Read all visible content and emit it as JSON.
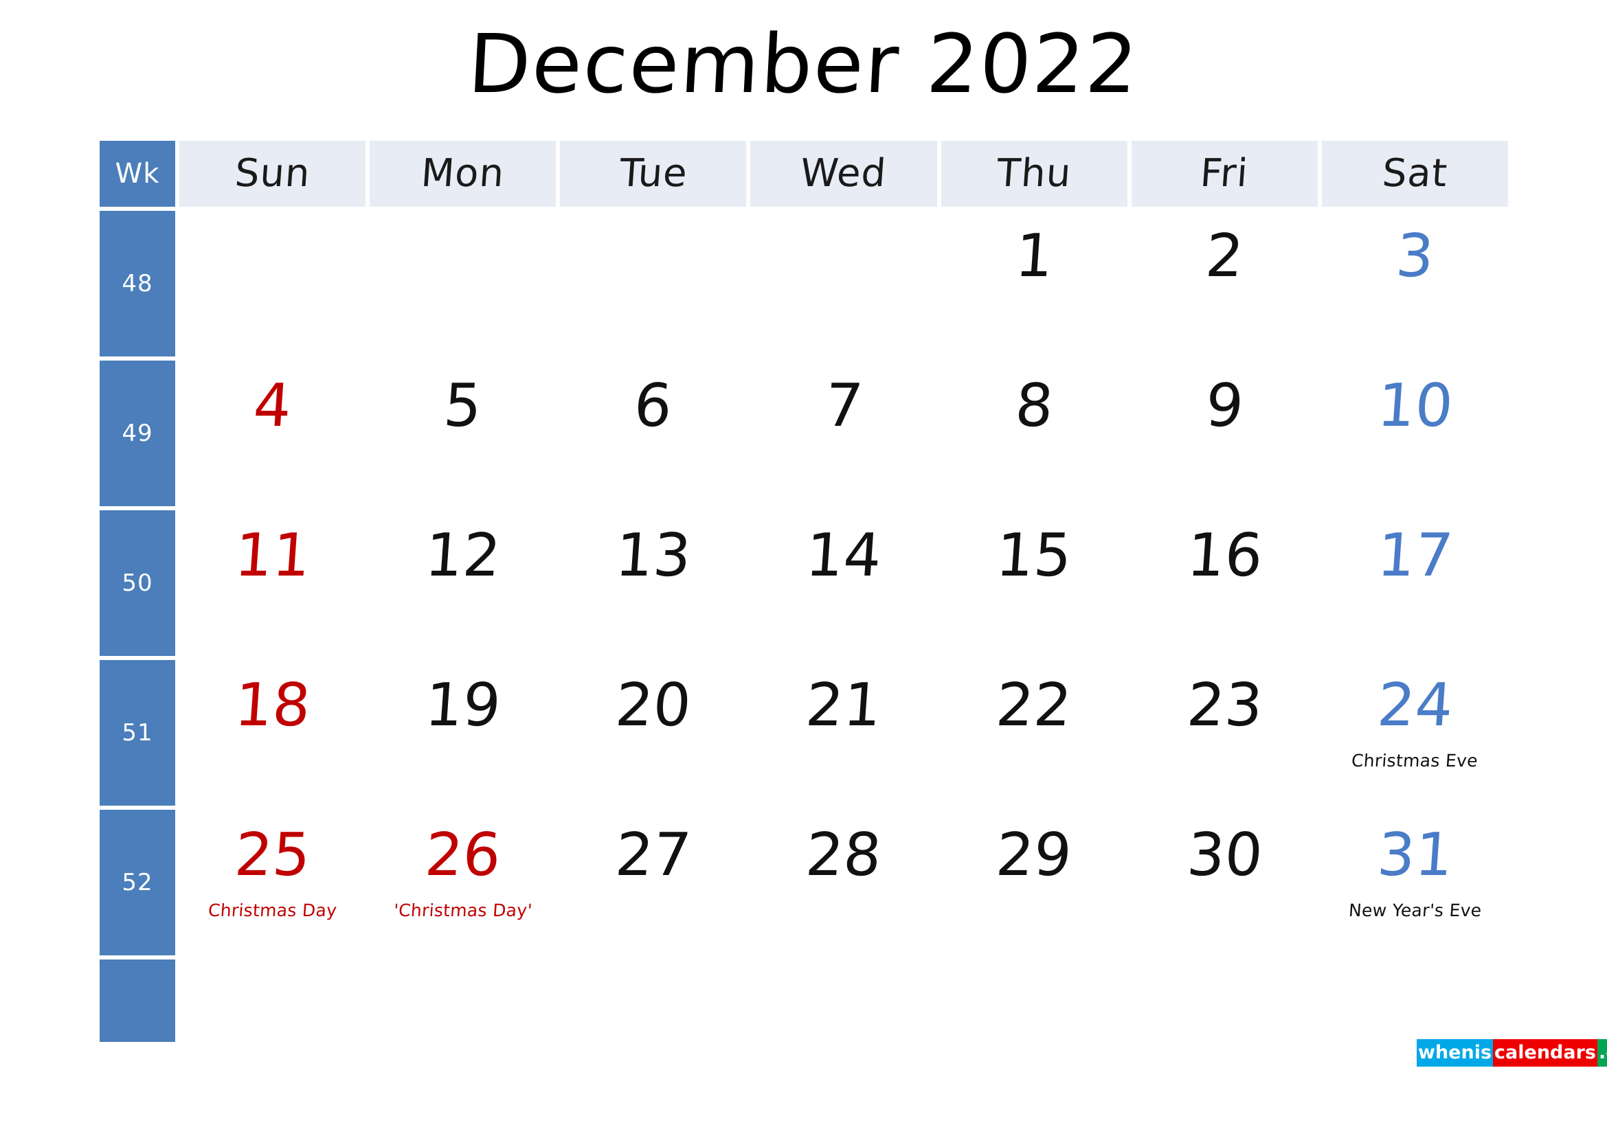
{
  "title": "December 2022",
  "colors": {
    "week_column_bg": "#4b7eba",
    "header_cell_bg": "#e8ecf4",
    "sunday_red": "#c00000",
    "saturday_blue": "#4a7cc7",
    "weekday_black": "#111111",
    "page_bg": "#ffffff"
  },
  "header": {
    "week_label": "Wk",
    "days": [
      "Sun",
      "Mon",
      "Tue",
      "Wed",
      "Thu",
      "Fri",
      "Sat"
    ]
  },
  "weeks": [
    {
      "week_number": "48",
      "days": [
        {
          "date": "",
          "kind": "empty",
          "note": ""
        },
        {
          "date": "",
          "kind": "empty",
          "note": ""
        },
        {
          "date": "",
          "kind": "empty",
          "note": ""
        },
        {
          "date": "",
          "kind": "empty",
          "note": ""
        },
        {
          "date": "1",
          "kind": "weekday",
          "note": ""
        },
        {
          "date": "2",
          "kind": "weekday",
          "note": ""
        },
        {
          "date": "3",
          "kind": "saturday",
          "note": ""
        }
      ]
    },
    {
      "week_number": "49",
      "days": [
        {
          "date": "4",
          "kind": "sunday",
          "note": ""
        },
        {
          "date": "5",
          "kind": "weekday",
          "note": ""
        },
        {
          "date": "6",
          "kind": "weekday",
          "note": ""
        },
        {
          "date": "7",
          "kind": "weekday",
          "note": ""
        },
        {
          "date": "8",
          "kind": "weekday",
          "note": ""
        },
        {
          "date": "9",
          "kind": "weekday",
          "note": ""
        },
        {
          "date": "10",
          "kind": "saturday",
          "note": ""
        }
      ]
    },
    {
      "week_number": "50",
      "days": [
        {
          "date": "11",
          "kind": "sunday",
          "note": ""
        },
        {
          "date": "12",
          "kind": "weekday",
          "note": ""
        },
        {
          "date": "13",
          "kind": "weekday",
          "note": ""
        },
        {
          "date": "14",
          "kind": "weekday",
          "note": ""
        },
        {
          "date": "15",
          "kind": "weekday",
          "note": ""
        },
        {
          "date": "16",
          "kind": "weekday",
          "note": ""
        },
        {
          "date": "17",
          "kind": "saturday",
          "note": ""
        }
      ]
    },
    {
      "week_number": "51",
      "days": [
        {
          "date": "18",
          "kind": "sunday",
          "note": ""
        },
        {
          "date": "19",
          "kind": "weekday",
          "note": ""
        },
        {
          "date": "20",
          "kind": "weekday",
          "note": ""
        },
        {
          "date": "21",
          "kind": "weekday",
          "note": ""
        },
        {
          "date": "22",
          "kind": "weekday",
          "note": ""
        },
        {
          "date": "23",
          "kind": "weekday",
          "note": ""
        },
        {
          "date": "24",
          "kind": "saturday",
          "note": "Christmas Eve",
          "note_color": "black"
        }
      ]
    },
    {
      "week_number": "52",
      "days": [
        {
          "date": "25",
          "kind": "sunday",
          "note": "Christmas Day",
          "note_color": "red"
        },
        {
          "date": "26",
          "kind": "holiday-red",
          "note": "'Christmas Day'",
          "note_color": "red"
        },
        {
          "date": "27",
          "kind": "weekday",
          "note": ""
        },
        {
          "date": "28",
          "kind": "weekday",
          "note": ""
        },
        {
          "date": "29",
          "kind": "weekday",
          "note": ""
        },
        {
          "date": "30",
          "kind": "weekday",
          "note": ""
        },
        {
          "date": "31",
          "kind": "saturday",
          "note": "New Year's Eve",
          "note_color": "black"
        }
      ]
    },
    {
      "week_number": "",
      "days": [
        {
          "date": "",
          "kind": "empty",
          "note": ""
        },
        {
          "date": "",
          "kind": "empty",
          "note": ""
        },
        {
          "date": "",
          "kind": "empty",
          "note": ""
        },
        {
          "date": "",
          "kind": "empty",
          "note": ""
        },
        {
          "date": "",
          "kind": "empty",
          "note": ""
        },
        {
          "date": "",
          "kind": "empty",
          "note": ""
        },
        {
          "date": "",
          "kind": "empty",
          "note": ""
        }
      ]
    }
  ],
  "logo": {
    "part1": "whenis",
    "part2": "calendars",
    "part3": ".com"
  }
}
